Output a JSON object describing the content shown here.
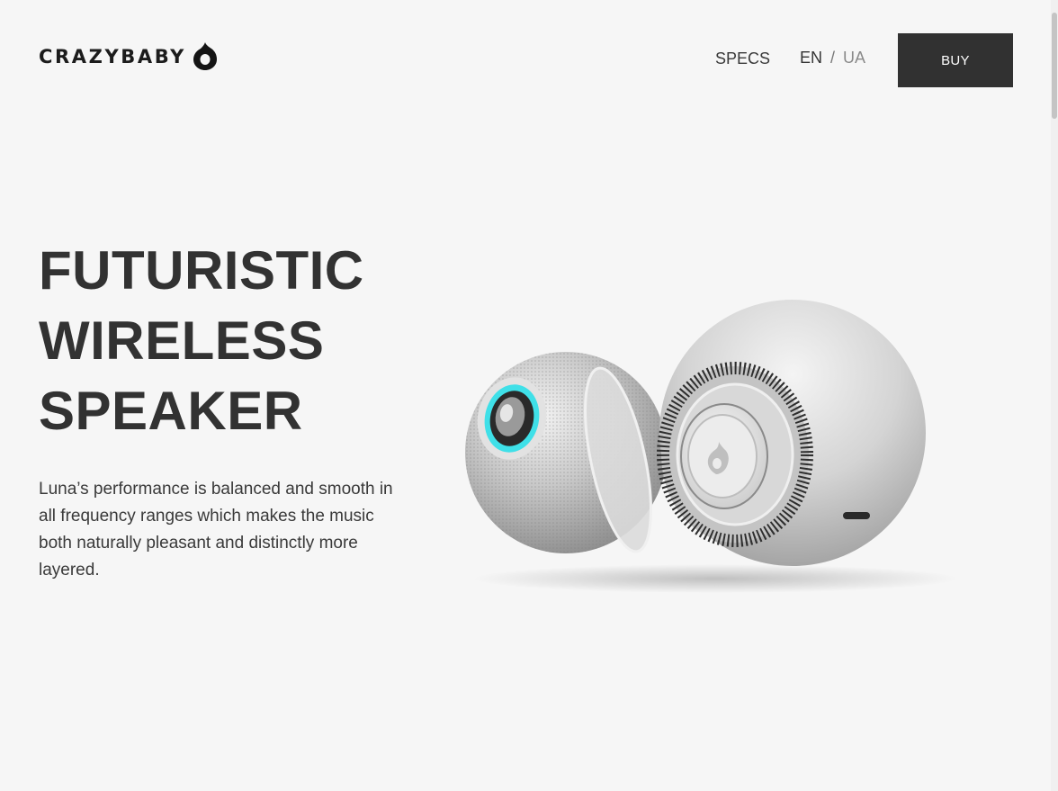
{
  "header": {
    "logo_text": "CRAZYBABY",
    "nav_specs": "SPECS",
    "lang_en": "EN",
    "lang_separator": "/",
    "lang_ua": "UA",
    "buy_label": "BUY"
  },
  "hero": {
    "title_lines": [
      "FUTURISTIC",
      "WIRELESS",
      "SPEAKER"
    ],
    "description": "Luna’s performance is balanced and smooth in all frequency ranges which makes the music both naturally pleasant and distinctly more layered."
  },
  "colors": {
    "background": "#f6f6f6",
    "text": "#333333",
    "button": "#313131",
    "accent_cyan": "#3fe0e8"
  },
  "icons": {
    "logo_mark": "drop-logo-icon"
  }
}
